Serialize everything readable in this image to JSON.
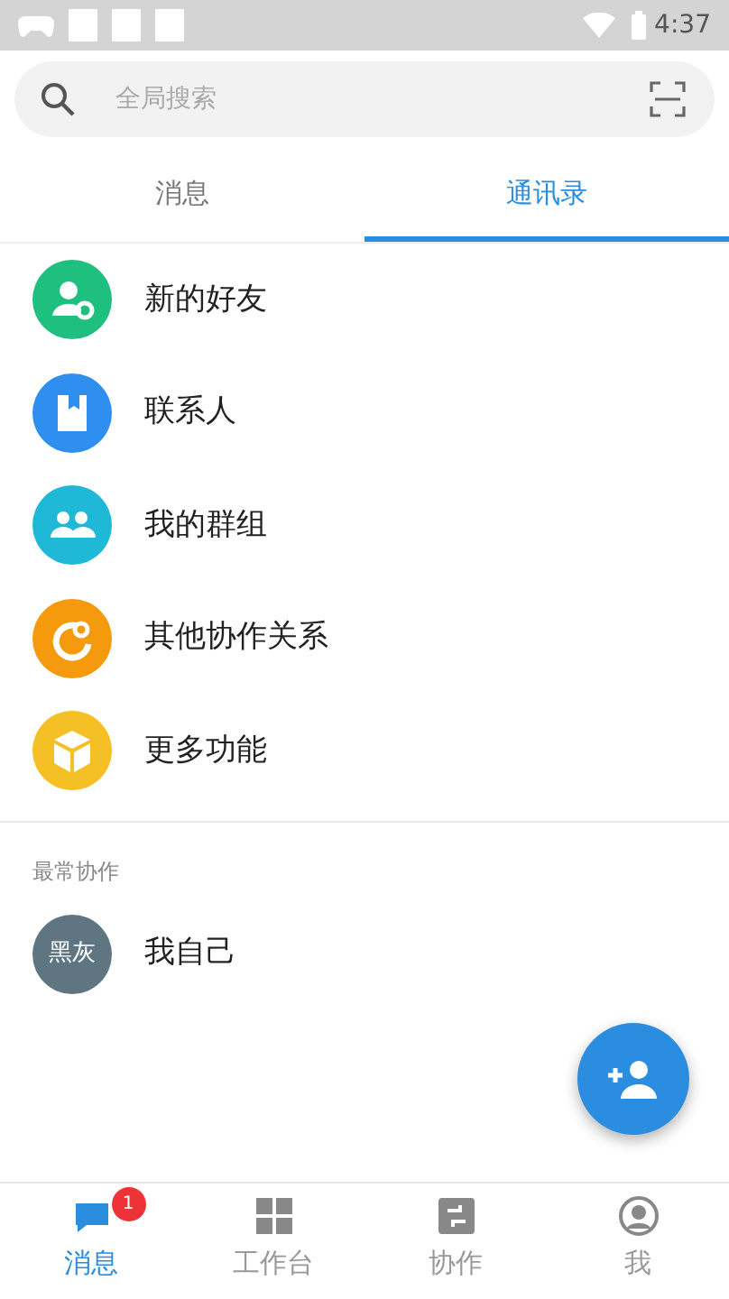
{
  "status_bar": {
    "time": "4:37"
  },
  "search": {
    "placeholder": "全局搜索"
  },
  "tabs": [
    {
      "label": "消息",
      "selected": false
    },
    {
      "label": "通讯录",
      "selected": true
    }
  ],
  "entries": [
    {
      "kind": "new-friend",
      "label": "新的好友",
      "color": "#1fbf7f"
    },
    {
      "kind": "contacts",
      "label": "联系人",
      "color": "#2f8ff0"
    },
    {
      "kind": "groups",
      "label": "我的群组",
      "color": "#1fb8d6"
    },
    {
      "kind": "other",
      "label": "其他协作关系",
      "color": "#f59a0c"
    },
    {
      "kind": "more",
      "label": "更多功能",
      "color": "#f5c026"
    }
  ],
  "frequent": {
    "heading": "最常协作",
    "items": [
      {
        "avatar": "黑灰",
        "name": "我自己"
      }
    ]
  },
  "bottom_nav": [
    {
      "kind": "chat",
      "label": "消息",
      "selected": true,
      "badge": "1"
    },
    {
      "kind": "grid",
      "label": "工作台",
      "selected": false
    },
    {
      "kind": "collab",
      "label": "协作",
      "selected": false
    },
    {
      "kind": "person",
      "label": "我",
      "selected": false
    }
  ]
}
